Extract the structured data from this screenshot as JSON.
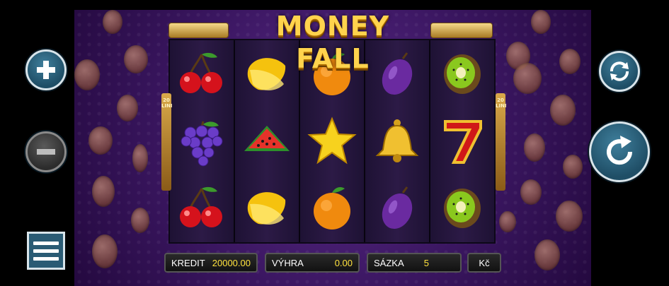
{
  "game": {
    "title": "MONEY FALL",
    "lines_label_left": "20 LINI",
    "lines_label_right": "20 LINI"
  },
  "reels": [
    [
      "cherry",
      "grapes",
      "cherry"
    ],
    [
      "lemon",
      "watermelon",
      "lemon"
    ],
    [
      "orange",
      "star",
      "orange"
    ],
    [
      "plum",
      "bell",
      "plum"
    ],
    [
      "kiwi",
      "seven",
      "kiwi"
    ]
  ],
  "info_bar": {
    "credit_label": "KREDIT",
    "credit_value": "20000.00",
    "win_label": "VÝHRA",
    "win_value": "0.00",
    "bet_label": "SÁZKA",
    "bet_value": "5",
    "currency": "Kč"
  },
  "buttons": {
    "increase": "plus-icon",
    "decrease": "minus-icon",
    "autoplay": "autoplay-icon",
    "spin": "spin-icon",
    "menu": "menu-icon"
  },
  "colors": {
    "background": "#3a1660",
    "title": "#ffd34d",
    "value_text": "#ffe23d",
    "button": "#1f4e66"
  }
}
